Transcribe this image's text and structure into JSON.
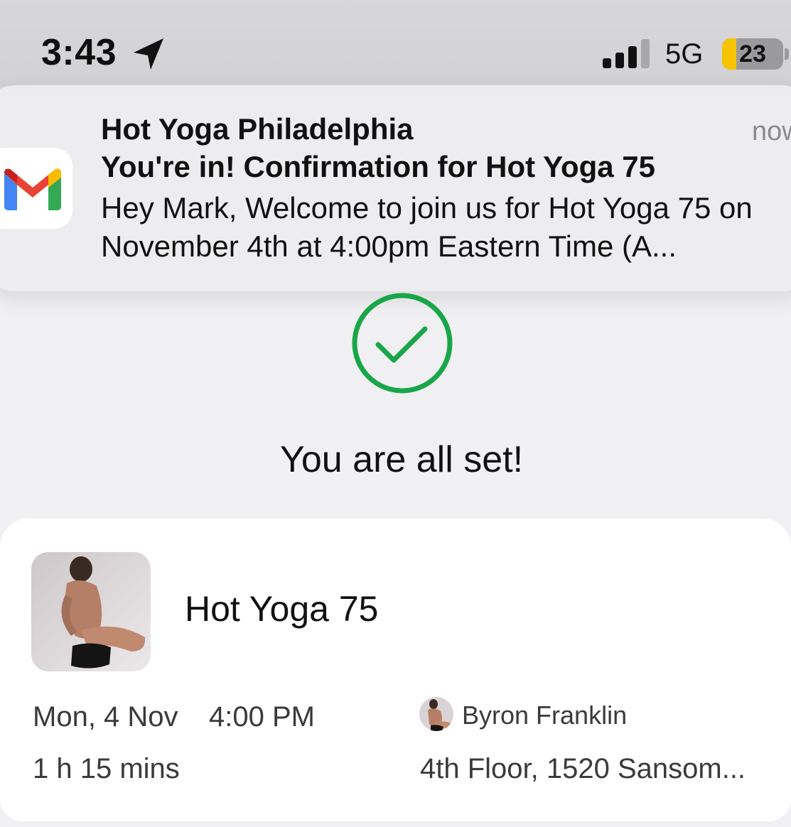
{
  "status_bar": {
    "time": "3:43",
    "location_icon": "location-arrow-icon",
    "signal_icon": "cellular-signal-icon",
    "network": "5G",
    "battery_percent": "23",
    "battery_level": 0.23,
    "battery_color": "#f6c400"
  },
  "notification": {
    "app_icon": "gmail-icon",
    "sender": "Hot Yoga Philadelphia",
    "time": "now",
    "subject": "You're in! Confirmation for Hot Yoga 75",
    "body": "Hey Mark, Welcome to join us for Hot Yoga 75 on November 4th at 4:00pm Eastern Time (A..."
  },
  "confirmation": {
    "icon": "checkmark-circle-icon",
    "accent_color": "#19a64a",
    "title": "You are all set!"
  },
  "class_card": {
    "thumbnail": "yoga-pose-photo",
    "name": "Hot Yoga 75",
    "date": "Mon, 4 Nov",
    "time": "4:00 PM",
    "duration": "1 h 15 mins",
    "instructor": {
      "avatar": "instructor-avatar",
      "name": "Byron Franklin"
    },
    "location": "4th Floor, 1520 Sansom..."
  }
}
